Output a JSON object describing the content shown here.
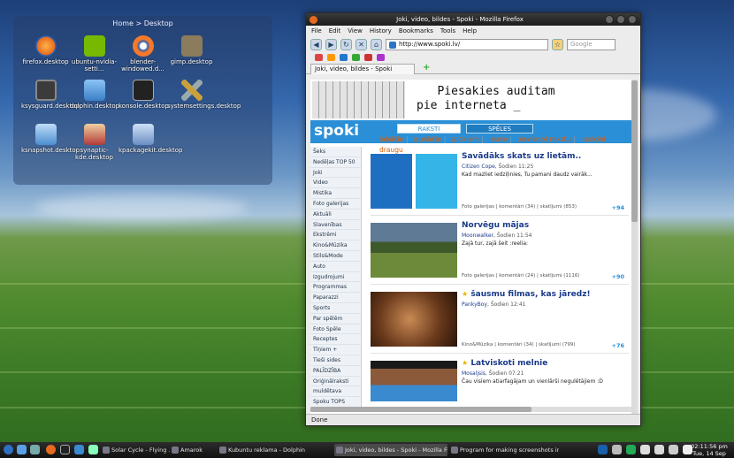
{
  "desktop": {
    "folderview_title": "Home > Desktop",
    "icons": [
      {
        "label": "firefox.desktop",
        "color": "#e66a1f"
      },
      {
        "label": "ubuntu-nvidia-setti...",
        "color": "#76b900"
      },
      {
        "label": "blender-windowed.d...",
        "color": "#f5792a"
      },
      {
        "label": "gimp.desktop",
        "color": "#8a7c5c"
      },
      {
        "label": "ksysguard.desktop",
        "color": "#3b3b3b"
      },
      {
        "label": "dolphin.desktop",
        "color": "#5aa0e6"
      },
      {
        "label": "konsole.desktop",
        "color": "#222222"
      },
      {
        "label": "systemsettings.desktop",
        "color": "#c9a13a"
      },
      {
        "label": "ksnapshot.desktop",
        "color": "#4b8ed1"
      },
      {
        "label": "synaptic-kde.desktop",
        "color": "#b33a3a"
      },
      {
        "label": "kpackagekit.desktop",
        "color": "#6b8fc4"
      }
    ]
  },
  "browser": {
    "title": "Joki, video, bildes - Spoki - Mozilla Firefox",
    "menu": [
      "File",
      "Edit",
      "View",
      "History",
      "Bookmarks",
      "Tools",
      "Help"
    ],
    "url": "http://www.spoki.lv/",
    "search_placeholder": "Google",
    "tab_label": "Joki, video, bildes - Spoki",
    "status": "Done"
  },
  "page": {
    "banner_text": "   Piesakies auditam\npie interneta _",
    "logo": "spoki",
    "tabs": [
      "RAKSTI",
      "SPĒLES"
    ],
    "subnav": [
      "labākie",
      "jaunākie",
      "spokiem",
      "izsole",
      "pievienot rakstu",
      "uzaicini draugu"
    ],
    "sidebar": [
      "Šeks",
      "Nedēļas TOP 50",
      "Joki",
      "Video",
      "Mistika",
      "Foto galerijas",
      "Aktuāli",
      "Slavenības",
      "Ekstrēmi",
      "Kino&Mūzika",
      "Stils&Mode",
      "Auto",
      "Izgudrojumi",
      "Programmas",
      "Paparazzi",
      "Sports",
      "Par spēlēm",
      "Foto Spēle",
      "Receptes",
      "Tīņiem +",
      "Tieši sides",
      "PALĪDZĪBA",
      "Oriģinālraksti",
      "muldētava",
      "Spoku TOPS"
    ],
    "articles": [
      {
        "title": "Savādāks skats uz lietām..",
        "author": "Citizen Cope",
        "time": "Šodien 11:25",
        "desc": "Kad mazliet iedziļinies, Tu pamani daudz vairāk...",
        "category": "Foto galerijas",
        "comments": "komentāri (34)",
        "views": "skatījumi (853)",
        "plus": "+94",
        "star": false
      },
      {
        "title": "Norvēgu mājas",
        "author": "Moonwalker",
        "time": "Šodien 11:54",
        "desc": "Zajā tur, zajā šeit :reelia:",
        "category": "Foto galerijas",
        "comments": "komentāri (24)",
        "views": "skatījumi (1116)",
        "plus": "+90",
        "star": false
      },
      {
        "title": "šausmu filmas, kas jāredz!",
        "author": "PankyBoy",
        "time": "Šodien 12:41",
        "desc": "",
        "category": "Kino&Mūzika",
        "comments": "komentāri (34)",
        "views": "skatījumi (799)",
        "plus": "+76",
        "star": true
      },
      {
        "title": "Latviskoti melnie",
        "author": "Mosaljsis",
        "time": "Šodien 07:21",
        "desc": "Čau visiem atiarfagājam un vienlārši negulētājiem :D",
        "category": "",
        "comments": "",
        "views": "",
        "plus": "",
        "star": true
      }
    ]
  },
  "taskbar": {
    "tasks": [
      "Solar Cycle - Flying ...",
      "Amarok",
      "Kubuntu reklama - Dolphin",
      "Joki, video, bildes - Spoki - Mozilla Fire...",
      "Program for making screenshots in l..."
    ],
    "clock_time": "02:11:56 pm",
    "clock_date": "Tue, 14 Sep"
  }
}
